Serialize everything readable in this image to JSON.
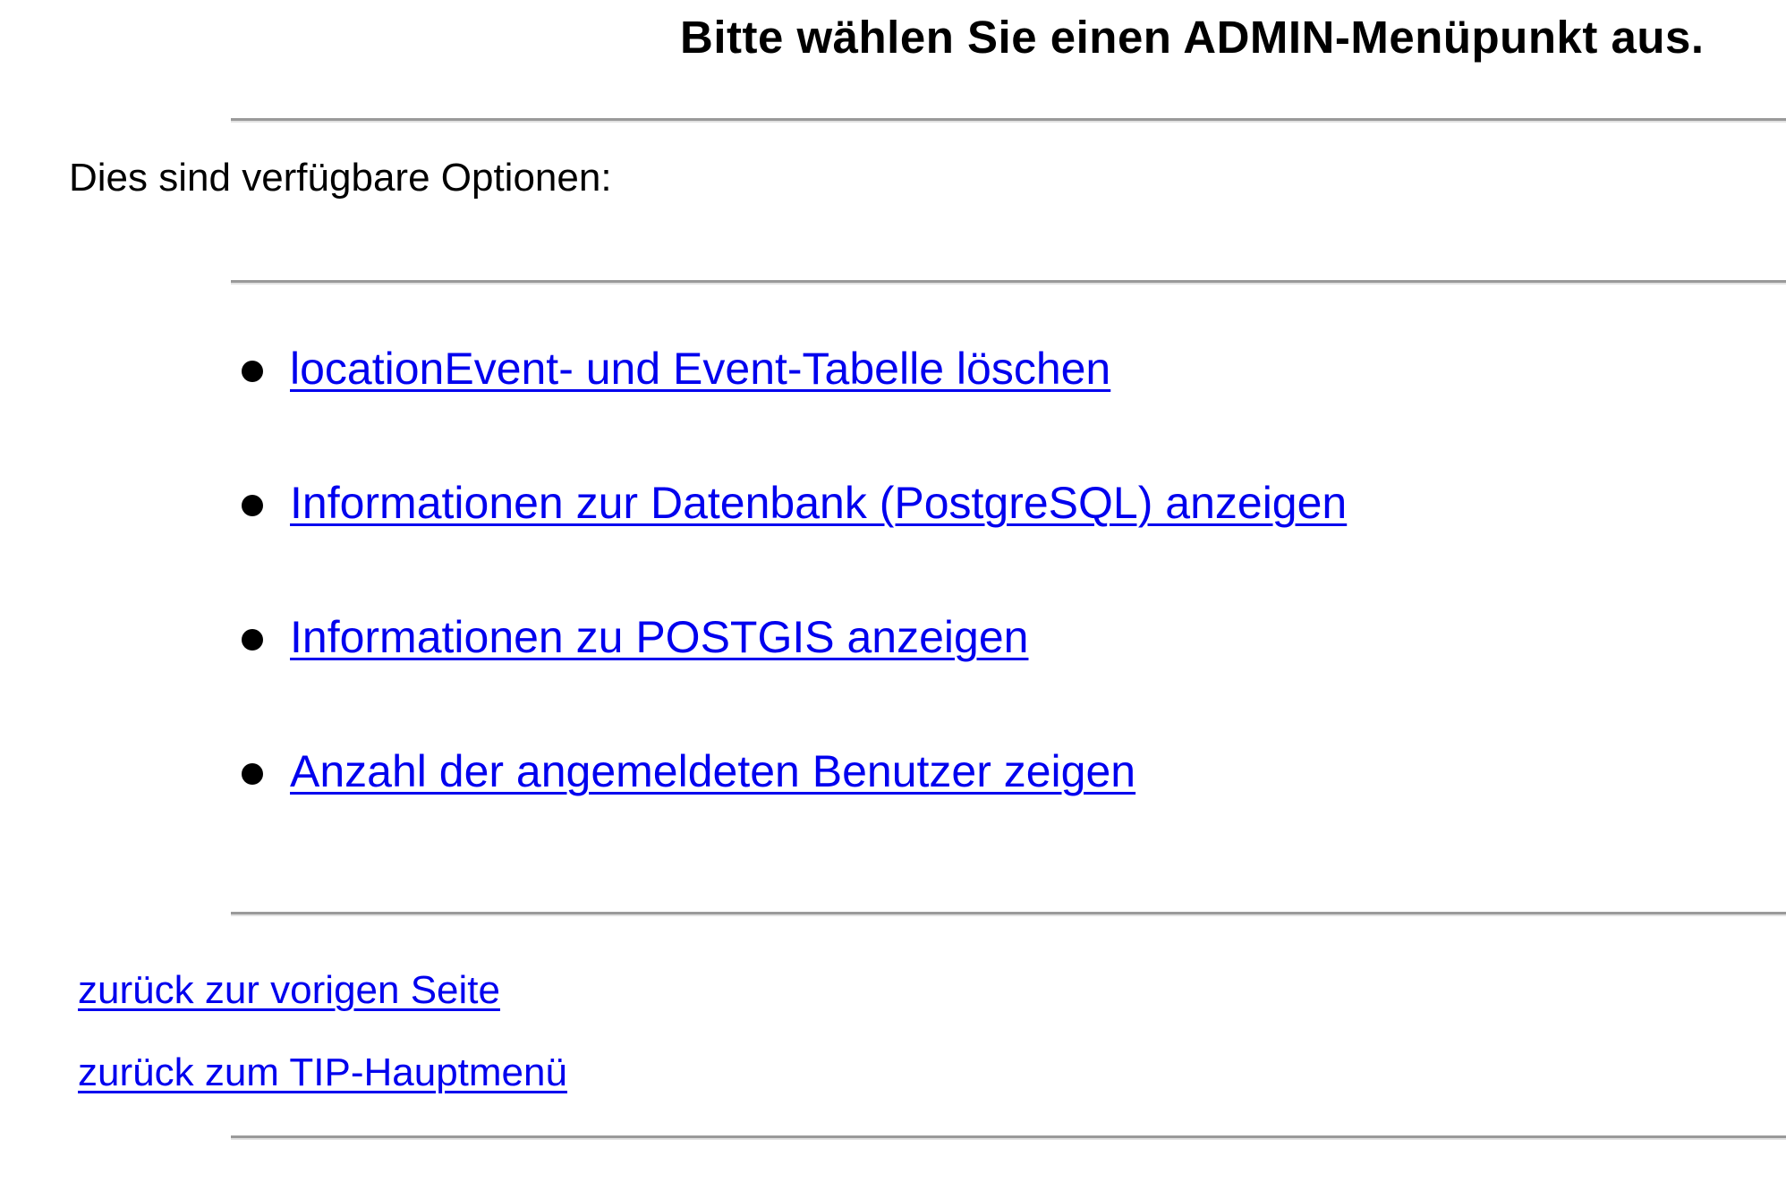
{
  "header": {
    "title": "Bitte wählen Sie einen ADMIN-Menüpunkt aus."
  },
  "intro": {
    "text": "Dies sind verfügbare Optionen:"
  },
  "options": [
    {
      "label": "locationEvent- und Event-Tabelle löschen"
    },
    {
      "label": "Informationen zur Datenbank (PostgreSQL) anzeigen"
    },
    {
      "label": "Informationen zu POSTGIS anzeigen"
    },
    {
      "label": "Anzahl der angemeldeten Benutzer zeigen"
    }
  ],
  "navigation": {
    "back_previous": "zurück zur vorigen Seite",
    "back_main_menu": "zurück zum TIP-Hauptmenü"
  },
  "colors": {
    "link": "#0000ee",
    "rule": "#9a9a9a",
    "text": "#000000",
    "background": "#ffffff"
  }
}
